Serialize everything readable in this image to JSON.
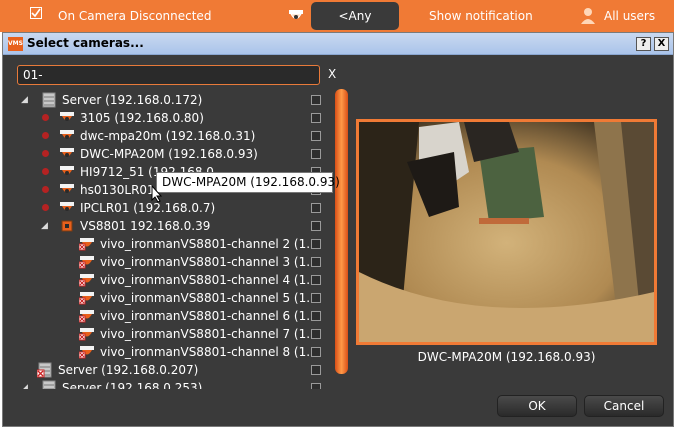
{
  "rule": {
    "event_label": "On Camera Disconnected",
    "camera_selector": "<Any Camera>",
    "action_label": "Show notification",
    "users_label": "All users"
  },
  "dialog": {
    "title": "Select cameras...",
    "help_label": "?",
    "close_label": "X",
    "search_value": "01-",
    "clear_label": "X",
    "tooltip": "DWC-MPA20M (192.168.0.93)",
    "preview_caption": "DWC-MPA20M (192.168.0.93)",
    "ok_label": "OK",
    "cancel_label": "Cancel"
  },
  "tree": [
    {
      "label": "Server (192.168.0.172)",
      "kind": "server",
      "expander": "◢"
    },
    {
      "label": "3105 (192.168.0.80)",
      "kind": "camera",
      "dot": true
    },
    {
      "label": "dwc-mpa20m (192.168.0.31)",
      "kind": "camera",
      "dot": true
    },
    {
      "label": "DWC-MPA20M (192.168.0.93)",
      "kind": "camera",
      "dot": true
    },
    {
      "label": "HI9712_51 (192.168.0.",
      "kind": "camera",
      "dot": true
    },
    {
      "label": "hs0130LR01",
      "kind": "camera",
      "dot": true
    },
    {
      "label": "IPCLR01 (192.168.0.7)",
      "kind": "camera",
      "dot": true
    },
    {
      "label": "VS8801 192.168.0.39",
      "kind": "encoder",
      "expander": "◢"
    },
    {
      "label": "vivo_ironmanVS8801-channel 2 (1...",
      "kind": "channel"
    },
    {
      "label": "vivo_ironmanVS8801-channel 3 (1...",
      "kind": "channel"
    },
    {
      "label": "vivo_ironmanVS8801-channel 4 (1...",
      "kind": "channel"
    },
    {
      "label": "vivo_ironmanVS8801-channel 5 (1...",
      "kind": "channel"
    },
    {
      "label": "vivo_ironmanVS8801-channel 6 (1...",
      "kind": "channel"
    },
    {
      "label": "vivo_ironmanVS8801-channel 7 (1...",
      "kind": "channel"
    },
    {
      "label": "vivo_ironmanVS8801-channel 8 (1...",
      "kind": "channel"
    },
    {
      "label": "Server (192.168.0.207)",
      "kind": "server-offline"
    },
    {
      "label": "Server (192.168.0.253)",
      "kind": "server",
      "expander": "◢"
    }
  ],
  "colors": {
    "accent": "#f07a35",
    "dialog_bg": "#3a3a3a",
    "status_dot": "#b52222"
  }
}
